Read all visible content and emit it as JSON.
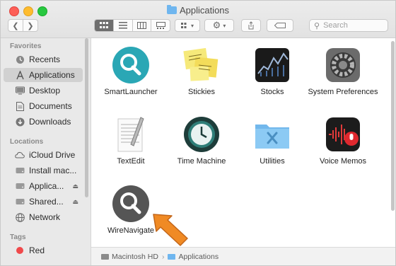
{
  "window": {
    "title": "Applications"
  },
  "toolbar": {
    "back_icon": "chevron-left-icon",
    "forward_icon": "chevron-right-icon",
    "view_modes": [
      "icon-view",
      "list-view",
      "column-view",
      "gallery-view"
    ],
    "search_placeholder": "Search"
  },
  "sidebar": {
    "favorites_header": "Favorites",
    "favorites": [
      {
        "label": "Recents",
        "icon": "clock-icon"
      },
      {
        "label": "Applications",
        "icon": "applications-icon",
        "active": true
      },
      {
        "label": "Desktop",
        "icon": "desktop-icon"
      },
      {
        "label": "Documents",
        "icon": "document-icon"
      },
      {
        "label": "Downloads",
        "icon": "download-icon"
      }
    ],
    "locations_header": "Locations",
    "locations": [
      {
        "label": "iCloud Drive",
        "icon": "cloud-icon"
      },
      {
        "label": "Install mac...",
        "icon": "disk-icon"
      },
      {
        "label": "Applica...",
        "icon": "disk-icon",
        "eject": true
      },
      {
        "label": "Shared...",
        "icon": "disk-icon",
        "eject": true
      },
      {
        "label": "Network",
        "icon": "globe-icon"
      }
    ],
    "tags_header": "Tags",
    "tags": [
      {
        "label": "Red",
        "color": "#f0494b"
      }
    ]
  },
  "apps": [
    {
      "name": "SmartLauncher",
      "icon": "magnifier-teal-icon"
    },
    {
      "name": "Stickies",
      "icon": "stickies-icon"
    },
    {
      "name": "Stocks",
      "icon": "stocks-icon"
    },
    {
      "name": "System Preferences",
      "icon": "gear-icon"
    },
    {
      "name": "TextEdit",
      "icon": "textedit-icon"
    },
    {
      "name": "Time Machine",
      "icon": "time-machine-icon"
    },
    {
      "name": "Utilities",
      "icon": "utilities-folder-icon"
    },
    {
      "name": "Voice Memos",
      "icon": "voice-memos-icon"
    },
    {
      "name": "WireNavigate",
      "icon": "magnifier-gray-icon"
    }
  ],
  "pathbar": {
    "disk": "Macintosh HD",
    "folder": "Applications"
  },
  "colors": {
    "teal": "#2aa7b5",
    "arrow": "#f08a24",
    "sidebar_bg": "#e9e9e9"
  }
}
